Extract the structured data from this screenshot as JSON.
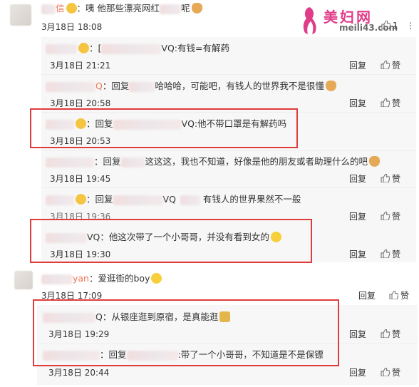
{
  "watermark": {
    "title": "美妇网",
    "url": "meili43.com"
  },
  "top_comment": {
    "name_suffix": "信",
    "text": "：咦 他那些漂亮网红",
    "text_tail": "呢",
    "time": "3月18日 18:08",
    "like_count": "1"
  },
  "replies_a": [
    {
      "name": "",
      "text": "VQ:有钱=有解药",
      "prefix": "：[",
      "time": "3月18日 21:21",
      "reply": "回复",
      "like": "赞"
    },
    {
      "name": "Q",
      "text": "：回复",
      "text2": "哈哈哈，可能吧，有钱人的世界我不是很懂",
      "time": "3月18日 20:58",
      "reply": "回复",
      "like": "赞"
    },
    {
      "name": "",
      "text": "：回复",
      "text2": "VQ:他不带口罩是有解药吗",
      "time": "3月18日 20:53",
      "reply": "回复",
      "like": "赞"
    },
    {
      "name": "",
      "text": "：回复",
      "text2": "这这这，我也不知道，好像是他的朋友或者助理什么的吧",
      "time": "3月18日 19:45",
      "reply": "回复",
      "like": "赞"
    },
    {
      "name": "",
      "text": "：回复",
      "text2": "VQ",
      "text3": "有钱人的世界果然不一般",
      "time": "3月18日 19:36",
      "reply": "回复",
      "like": "赞"
    },
    {
      "name": "",
      "text": "VQ：他这次带了一个小哥哥，并没有看到女的",
      "time": "3月18日 19:30",
      "reply": "回复",
      "like": "赞"
    }
  ],
  "second_comment": {
    "name_suffix": "yan",
    "text": "：爱逛街的boy",
    "time": "3月18日 17:09",
    "reply": "回复",
    "like": "赞"
  },
  "replies_b": [
    {
      "text": "Q：从银座逛到原宿，是真能逛",
      "time": "3月18日 19:29",
      "reply": "回复",
      "like": "赞"
    },
    {
      "text": "：回复",
      "text2": ":带了一个小哥哥，不知道是不是保镖",
      "time": "3月18日 20:44",
      "reply": "回复",
      "like": "赞"
    }
  ],
  "colors": {
    "highlight": "#e03c3c",
    "username": "#eb7350",
    "reply_bg": "#f7f7f7"
  }
}
